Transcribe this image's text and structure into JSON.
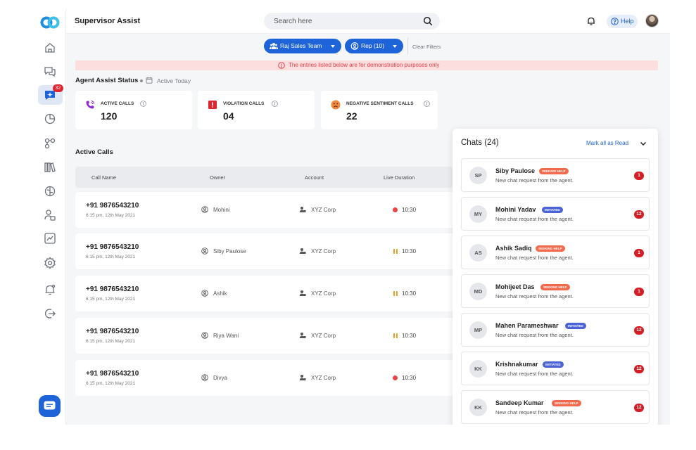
{
  "header": {
    "app_title": "Supervisor Assist",
    "search_placeholder": "Search here",
    "help_label": "Help"
  },
  "sidebar": {
    "items": [
      "home-icon",
      "chat-bubbles-icon",
      "agent-assist-icon",
      "analytics-icon",
      "nodes-icon",
      "library-icon",
      "brain-icon",
      "users-icon",
      "trend-icon",
      "settings-icon",
      "alerts-icon",
      "logout-icon"
    ],
    "active_badge": "32"
  },
  "filters": {
    "team": "Raj Sales Team",
    "rep": "Rep (10)",
    "clear": "Clear Filters"
  },
  "banner": "The entries listed below are for demonstration purposes only",
  "agent_status": {
    "title": "Agent Assist Status",
    "period": "Active Today",
    "stats": [
      {
        "label": "ACTIVE CALLS",
        "value": "120"
      },
      {
        "label": "VIOLATION CALLS",
        "value": "04"
      },
      {
        "label": "NEGATIVE SENTIMENT CALLS",
        "value": "22"
      }
    ]
  },
  "active_calls": {
    "title": "Active Calls",
    "columns": [
      "Call Name",
      "Owner",
      "Account",
      "Live Duration"
    ],
    "rows": [
      {
        "phone": "+91 9876543210",
        "time": "6:15 pm, 12th May 2021",
        "owner": "Mohini",
        "account": "XYZ Corp",
        "duration": "10:30",
        "state": "live"
      },
      {
        "phone": "+91 9876543210",
        "time": "6:15 pm, 12th May 2021",
        "owner": "Siby Paulose",
        "account": "XYZ Corp",
        "duration": "10:30",
        "state": "paused"
      },
      {
        "phone": "+91 9876543210",
        "time": "6:15 pm, 12th May 2021",
        "owner": "Ashik",
        "account": "XYZ Corp",
        "duration": "10:30",
        "state": "paused"
      },
      {
        "phone": "+91 9876543210",
        "time": "6:15 pm, 12th May 2021",
        "owner": "Riya Wani",
        "account": "XYZ Corp",
        "duration": "10:30",
        "state": "paused"
      },
      {
        "phone": "+91 9876543210",
        "time": "6:15 pm, 12th May 2021",
        "owner": "Divya",
        "account": "XYZ Corp",
        "duration": "10:30",
        "state": "live"
      }
    ]
  },
  "chats": {
    "title": "Chats (24)",
    "mark_all": "Mark all as Read",
    "items": [
      {
        "initials": "SP",
        "name": "Siby Paulose",
        "tag": "SEEKING HELP",
        "tag_type": "seek",
        "message": "New chat request from the agent.",
        "count": "1"
      },
      {
        "initials": "MY",
        "name": "Mohini Yadav",
        "tag": "INITIATED",
        "tag_type": "init",
        "message": "New chat request from the agent.",
        "count": "12"
      },
      {
        "initials": "AS",
        "name": "Ashik Sadiq",
        "tag": "SEEKING HELP",
        "tag_type": "seek",
        "message": "New chat request from the agent.",
        "count": "1"
      },
      {
        "initials": "MD",
        "name": "Mohijeet Das",
        "tag": "SEEKING HELP",
        "tag_type": "seek",
        "message": "New chat request from the agent.",
        "count": "1"
      },
      {
        "initials": "MP",
        "name": "Mahen Parameshwar",
        "tag": "INITIATED",
        "tag_type": "init",
        "message": "New chat request from the agent.",
        "count": "12"
      },
      {
        "initials": "KK",
        "name": "Krishnakumar",
        "tag": "INITIATED",
        "tag_type": "init",
        "message": "New chat request from the agent.",
        "count": "12"
      },
      {
        "initials": "KK",
        "name": "Sandeep Kumar",
        "tag": "SEEKING HELP",
        "tag_type": "seek",
        "message": "New chat request from the agent.",
        "count": "12"
      }
    ]
  },
  "colors": {
    "primary": "#1e63d8",
    "danger": "#d41d25",
    "seeking": "#f26a4b",
    "initiated": "#4b63d6"
  }
}
